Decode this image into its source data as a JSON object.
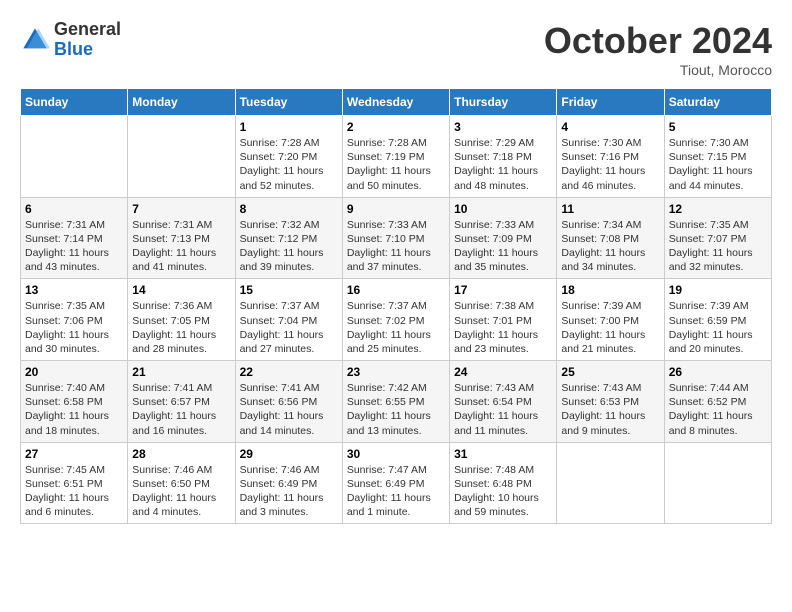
{
  "header": {
    "logo": {
      "line1": "General",
      "line2": "Blue"
    },
    "title": "October 2024",
    "location": "Tiout, Morocco"
  },
  "days_of_week": [
    "Sunday",
    "Monday",
    "Tuesday",
    "Wednesday",
    "Thursday",
    "Friday",
    "Saturday"
  ],
  "weeks": [
    [
      {
        "day": null,
        "info": null
      },
      {
        "day": null,
        "info": null
      },
      {
        "day": "1",
        "info": "Sunrise: 7:28 AM\nSunset: 7:20 PM\nDaylight: 11 hours and 52 minutes."
      },
      {
        "day": "2",
        "info": "Sunrise: 7:28 AM\nSunset: 7:19 PM\nDaylight: 11 hours and 50 minutes."
      },
      {
        "day": "3",
        "info": "Sunrise: 7:29 AM\nSunset: 7:18 PM\nDaylight: 11 hours and 48 minutes."
      },
      {
        "day": "4",
        "info": "Sunrise: 7:30 AM\nSunset: 7:16 PM\nDaylight: 11 hours and 46 minutes."
      },
      {
        "day": "5",
        "info": "Sunrise: 7:30 AM\nSunset: 7:15 PM\nDaylight: 11 hours and 44 minutes."
      }
    ],
    [
      {
        "day": "6",
        "info": "Sunrise: 7:31 AM\nSunset: 7:14 PM\nDaylight: 11 hours and 43 minutes."
      },
      {
        "day": "7",
        "info": "Sunrise: 7:31 AM\nSunset: 7:13 PM\nDaylight: 11 hours and 41 minutes."
      },
      {
        "day": "8",
        "info": "Sunrise: 7:32 AM\nSunset: 7:12 PM\nDaylight: 11 hours and 39 minutes."
      },
      {
        "day": "9",
        "info": "Sunrise: 7:33 AM\nSunset: 7:10 PM\nDaylight: 11 hours and 37 minutes."
      },
      {
        "day": "10",
        "info": "Sunrise: 7:33 AM\nSunset: 7:09 PM\nDaylight: 11 hours and 35 minutes."
      },
      {
        "day": "11",
        "info": "Sunrise: 7:34 AM\nSunset: 7:08 PM\nDaylight: 11 hours and 34 minutes."
      },
      {
        "day": "12",
        "info": "Sunrise: 7:35 AM\nSunset: 7:07 PM\nDaylight: 11 hours and 32 minutes."
      }
    ],
    [
      {
        "day": "13",
        "info": "Sunrise: 7:35 AM\nSunset: 7:06 PM\nDaylight: 11 hours and 30 minutes."
      },
      {
        "day": "14",
        "info": "Sunrise: 7:36 AM\nSunset: 7:05 PM\nDaylight: 11 hours and 28 minutes."
      },
      {
        "day": "15",
        "info": "Sunrise: 7:37 AM\nSunset: 7:04 PM\nDaylight: 11 hours and 27 minutes."
      },
      {
        "day": "16",
        "info": "Sunrise: 7:37 AM\nSunset: 7:02 PM\nDaylight: 11 hours and 25 minutes."
      },
      {
        "day": "17",
        "info": "Sunrise: 7:38 AM\nSunset: 7:01 PM\nDaylight: 11 hours and 23 minutes."
      },
      {
        "day": "18",
        "info": "Sunrise: 7:39 AM\nSunset: 7:00 PM\nDaylight: 11 hours and 21 minutes."
      },
      {
        "day": "19",
        "info": "Sunrise: 7:39 AM\nSunset: 6:59 PM\nDaylight: 11 hours and 20 minutes."
      }
    ],
    [
      {
        "day": "20",
        "info": "Sunrise: 7:40 AM\nSunset: 6:58 PM\nDaylight: 11 hours and 18 minutes."
      },
      {
        "day": "21",
        "info": "Sunrise: 7:41 AM\nSunset: 6:57 PM\nDaylight: 11 hours and 16 minutes."
      },
      {
        "day": "22",
        "info": "Sunrise: 7:41 AM\nSunset: 6:56 PM\nDaylight: 11 hours and 14 minutes."
      },
      {
        "day": "23",
        "info": "Sunrise: 7:42 AM\nSunset: 6:55 PM\nDaylight: 11 hours and 13 minutes."
      },
      {
        "day": "24",
        "info": "Sunrise: 7:43 AM\nSunset: 6:54 PM\nDaylight: 11 hours and 11 minutes."
      },
      {
        "day": "25",
        "info": "Sunrise: 7:43 AM\nSunset: 6:53 PM\nDaylight: 11 hours and 9 minutes."
      },
      {
        "day": "26",
        "info": "Sunrise: 7:44 AM\nSunset: 6:52 PM\nDaylight: 11 hours and 8 minutes."
      }
    ],
    [
      {
        "day": "27",
        "info": "Sunrise: 7:45 AM\nSunset: 6:51 PM\nDaylight: 11 hours and 6 minutes."
      },
      {
        "day": "28",
        "info": "Sunrise: 7:46 AM\nSunset: 6:50 PM\nDaylight: 11 hours and 4 minutes."
      },
      {
        "day": "29",
        "info": "Sunrise: 7:46 AM\nSunset: 6:49 PM\nDaylight: 11 hours and 3 minutes."
      },
      {
        "day": "30",
        "info": "Sunrise: 7:47 AM\nSunset: 6:49 PM\nDaylight: 11 hours and 1 minute."
      },
      {
        "day": "31",
        "info": "Sunrise: 7:48 AM\nSunset: 6:48 PM\nDaylight: 10 hours and 59 minutes."
      },
      {
        "day": null,
        "info": null
      },
      {
        "day": null,
        "info": null
      }
    ]
  ]
}
